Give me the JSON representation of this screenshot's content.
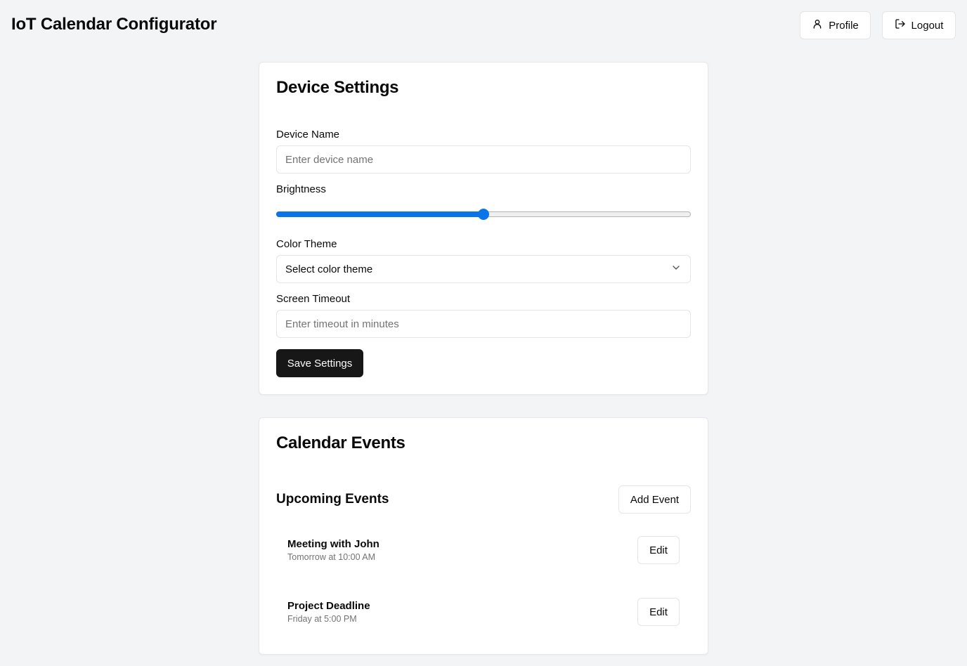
{
  "header": {
    "title": "IoT Calendar Configurator",
    "profile_label": "Profile",
    "logout_label": "Logout"
  },
  "settings": {
    "title": "Device Settings",
    "device_name": {
      "label": "Device Name",
      "placeholder": "Enter device name",
      "value": ""
    },
    "brightness": {
      "label": "Brightness",
      "value_percent": 50
    },
    "color_theme": {
      "label": "Color Theme",
      "selected": "Select color theme"
    },
    "screen_timeout": {
      "label": "Screen Timeout",
      "placeholder": "Enter timeout in minutes",
      "value": ""
    },
    "save_label": "Save Settings"
  },
  "events": {
    "title": "Calendar Events",
    "section_title": "Upcoming Events",
    "add_label": "Add Event",
    "items": [
      {
        "title": "Meeting with John",
        "time": "Tomorrow at 10:00 AM",
        "edit_label": "Edit"
      },
      {
        "title": "Project Deadline",
        "time": "Friday at 5:00 PM",
        "edit_label": "Edit"
      }
    ]
  },
  "colors": {
    "accent": "#0a74e8",
    "primary_button": "#171717",
    "background": "#f3f4f6"
  },
  "icons": {
    "profile": "user-icon",
    "logout": "log-out-icon",
    "select": "chevron-down-icon"
  }
}
